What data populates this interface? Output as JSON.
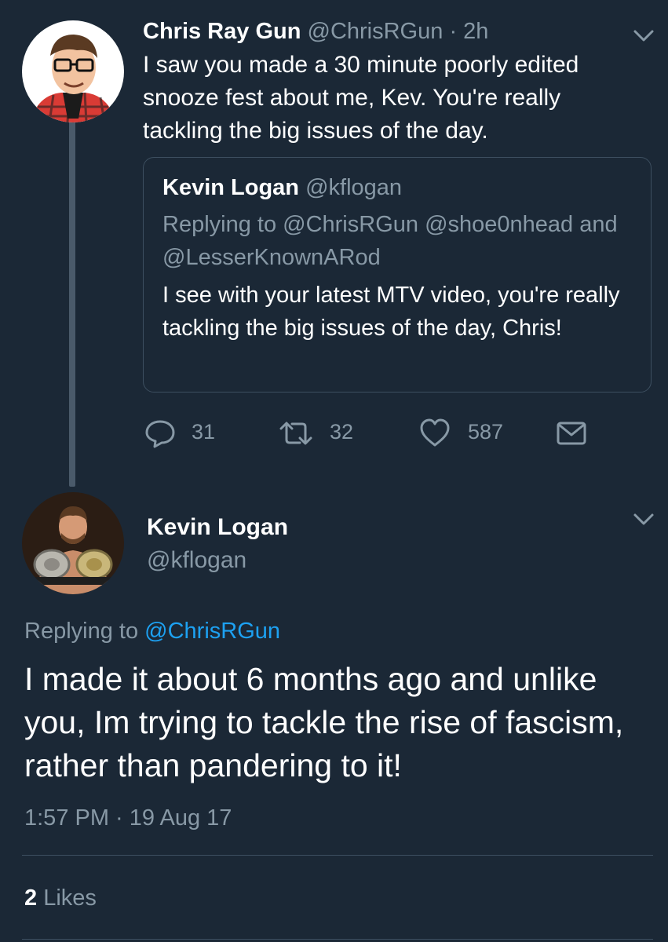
{
  "parent_tweet": {
    "name": "Chris Ray Gun",
    "handle": "@ChrisRGun",
    "separator": "·",
    "time": "2h",
    "text": "I saw you made a 30 minute poorly edited snooze fest about me, Kev. You're really tackling the big issues of the day.",
    "quoted_tweet": {
      "name": "Kevin Logan",
      "handle": "@kflogan",
      "replying_to": "Replying to @ChrisRGun @shoe0nhead and @LesserKnownARod",
      "text": "I see with your latest MTV video, you're really tackling the big issues of the day, Chris!"
    },
    "actions": {
      "replies": "31",
      "retweets": "32",
      "likes": "587"
    }
  },
  "reply_tweet": {
    "name": "Kevin Logan",
    "handle": "@kflogan",
    "replying_prefix": "Replying to",
    "replying_handle": "@ChrisRGun",
    "text": "I made it about 6 months ago and unlike you, Im trying to tackle the rise of fascism, rather than pandering to it!",
    "timestamp": "1:57 PM · 19 Aug 17",
    "likes_count": "2",
    "likes_label": "Likes"
  },
  "icons": {
    "reply": "reply-icon",
    "retweet": "retweet-icon",
    "like": "heart-icon",
    "dm": "envelope-icon",
    "menu": "chevron-down-icon"
  },
  "colors": {
    "background": "#1b2836",
    "secondary_text": "#8899a6",
    "link": "#1da1f2",
    "border": "#3d4f60"
  }
}
